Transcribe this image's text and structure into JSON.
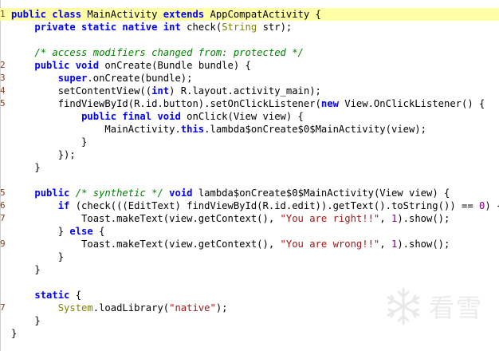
{
  "lines": [
    {
      "num": "1",
      "hl": true,
      "tokens": [
        [
          "kw",
          "public class "
        ],
        [
          "pl",
          "MainActivity "
        ],
        [
          "kw",
          "extends "
        ],
        [
          "pl",
          "AppCompatActivity {"
        ]
      ]
    },
    {
      "num": "",
      "tokens": [
        [
          "pl",
          "    "
        ],
        [
          "kw",
          "private static native "
        ],
        [
          "kw",
          "int "
        ],
        [
          "pl",
          "check("
        ],
        [
          "ty",
          "String "
        ],
        [
          "pl",
          "str);"
        ]
      ]
    },
    {
      "num": "",
      "tokens": []
    },
    {
      "num": "",
      "tokens": [
        [
          "pl",
          "    "
        ],
        [
          "cm",
          "/* access modifiers changed from: protected */"
        ]
      ]
    },
    {
      "num": "2",
      "tokens": [
        [
          "pl",
          "    "
        ],
        [
          "kw",
          "public void "
        ],
        [
          "pl",
          "onCreate(Bundle bundle) {"
        ]
      ]
    },
    {
      "num": "3",
      "tokens": [
        [
          "pl",
          "        "
        ],
        [
          "kw",
          "super"
        ],
        [
          "pl",
          ".onCreate(bundle);"
        ]
      ]
    },
    {
      "num": "4",
      "tokens": [
        [
          "pl",
          "        setContentView(("
        ],
        [
          "kw",
          "int"
        ],
        [
          "pl",
          ") R.layout.activity_main);"
        ]
      ]
    },
    {
      "num": "5",
      "tokens": [
        [
          "pl",
          "        findViewById(R.id.button).setOnClickListener("
        ],
        [
          "kw",
          "new "
        ],
        [
          "pl",
          "View.OnClickListener() {"
        ]
      ]
    },
    {
      "num": "",
      "tokens": [
        [
          "pl",
          "            "
        ],
        [
          "kw",
          "public final void "
        ],
        [
          "pl",
          "onClick(View view) {"
        ]
      ]
    },
    {
      "num": "",
      "tokens": [
        [
          "pl",
          "                MainActivity."
        ],
        [
          "kw",
          "this"
        ],
        [
          "pl",
          ".lambda$onCreate$0$MainActivity(view);"
        ]
      ]
    },
    {
      "num": "",
      "tokens": [
        [
          "pl",
          "            }"
        ]
      ]
    },
    {
      "num": "",
      "tokens": [
        [
          "pl",
          "        });"
        ]
      ]
    },
    {
      "num": "",
      "tokens": [
        [
          "pl",
          "    }"
        ]
      ]
    },
    {
      "num": "",
      "tokens": []
    },
    {
      "num": "5",
      "tokens": [
        [
          "pl",
          "    "
        ],
        [
          "kw",
          "public "
        ],
        [
          "cm",
          "/* synthetic */ "
        ],
        [
          "kw",
          "void "
        ],
        [
          "pl",
          "lambda$onCreate$0$MainActivity(View view) {"
        ]
      ]
    },
    {
      "num": "6",
      "tokens": [
        [
          "pl",
          "        "
        ],
        [
          "kw",
          "if "
        ],
        [
          "pl",
          "(check(((EditText) findViewById(R.id.edit)).getText().toString()) == "
        ],
        [
          "nu",
          "0"
        ],
        [
          "pl",
          ") {"
        ]
      ]
    },
    {
      "num": "7",
      "tokens": [
        [
          "pl",
          "            Toast.makeText(view.getContext(), "
        ],
        [
          "st",
          "\"You are right!!\""
        ],
        [
          "pl",
          ", "
        ],
        [
          "nu",
          "1"
        ],
        [
          "pl",
          ").show();"
        ]
      ]
    },
    {
      "num": "",
      "tokens": [
        [
          "pl",
          "        } "
        ],
        [
          "kw",
          "else "
        ],
        [
          "pl",
          "{"
        ]
      ]
    },
    {
      "num": "9",
      "tokens": [
        [
          "pl",
          "            Toast.makeText(view.getContext(), "
        ],
        [
          "st",
          "\"You are wrong!!\""
        ],
        [
          "pl",
          ", "
        ],
        [
          "nu",
          "1"
        ],
        [
          "pl",
          ").show();"
        ]
      ]
    },
    {
      "num": "",
      "tokens": [
        [
          "pl",
          "        }"
        ]
      ]
    },
    {
      "num": "",
      "tokens": [
        [
          "pl",
          "    }"
        ]
      ]
    },
    {
      "num": "",
      "tokens": []
    },
    {
      "num": "",
      "tokens": [
        [
          "pl",
          "    "
        ],
        [
          "kw",
          "static "
        ],
        [
          "pl",
          "{"
        ]
      ]
    },
    {
      "num": "7",
      "tokens": [
        [
          "pl",
          "        "
        ],
        [
          "ty",
          "System"
        ],
        [
          "pl",
          ".loadLibrary("
        ],
        [
          "st",
          "\"native\""
        ],
        [
          "pl",
          ");"
        ]
      ]
    },
    {
      "num": "",
      "tokens": [
        [
          "pl",
          "    }"
        ]
      ]
    },
    {
      "num": "",
      "tokens": [
        [
          "pl",
          "}"
        ]
      ]
    }
  ],
  "watermark": {
    "text": "看雪",
    "icon": "snowflake-logo-icon"
  }
}
